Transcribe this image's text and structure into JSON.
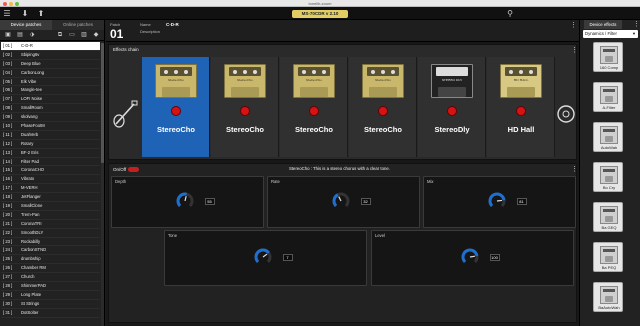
{
  "window": {
    "title": "tonelib-zoom"
  },
  "toolbar": {
    "device": "MS-70CDR v 2.10"
  },
  "left": {
    "tabs": [
      "Device patches",
      "Online patches"
    ],
    "patches": [
      {
        "num": "[ 01 ]",
        "name": "C-D-R"
      },
      {
        "num": "[ 02 ]",
        "name": "Sbiping6v"
      },
      {
        "num": "[ 03 ]",
        "name": "Deep Blue"
      },
      {
        "num": "[ 04 ]",
        "name": "CarbonLong"
      },
      {
        "num": "[ 05 ]",
        "name": "Elk Vibe"
      },
      {
        "num": "[ 06 ]",
        "name": "Mangle-tee"
      },
      {
        "num": "[ 07 ]",
        "name": "LOFI Noise"
      },
      {
        "num": "[ 08 ]",
        "name": "SmallRoom"
      },
      {
        "num": "[ 09 ]",
        "name": "skolvang"
      },
      {
        "num": "[ 10 ]",
        "name": "PhaseFootM"
      },
      {
        "num": "[ 11 ]",
        "name": "DualVerb"
      },
      {
        "num": "[ 12 ]",
        "name": "Rotary"
      },
      {
        "num": "[ 13 ]",
        "name": "BF-2 Eris"
      },
      {
        "num": "[ 14 ]",
        "name": "Filter Pad"
      },
      {
        "num": "[ 15 ]",
        "name": "CoronaCHO"
      },
      {
        "num": "[ 16 ]",
        "name": "Vibrato"
      },
      {
        "num": "[ 17 ]",
        "name": "M-VERH"
      },
      {
        "num": "[ 18 ]",
        "name": "JetFlanger"
      },
      {
        "num": "[ 19 ]",
        "name": "SmallClone"
      },
      {
        "num": "[ 20 ]",
        "name": "Trem-Pan"
      },
      {
        "num": "[ 21 ]",
        "name": "CoronaTRI"
      },
      {
        "num": "[ 22 ]",
        "name": "SmoothDLY"
      },
      {
        "num": "[ 23 ]",
        "name": "Rockabilly"
      },
      {
        "num": "[ 24 ]",
        "name": "CarbonSTND"
      },
      {
        "num": "[ 25 ]",
        "name": "drumbship"
      },
      {
        "num": "[ 26 ]",
        "name": "Chamber RM"
      },
      {
        "num": "[ 27 ]",
        "name": "Church"
      },
      {
        "num": "[ 28 ]",
        "name": "ShimmerPAD"
      },
      {
        "num": "[ 29 ]",
        "name": "Long Plate"
      },
      {
        "num": "[ 30 ]",
        "name": "St Strings"
      },
      {
        "num": "[ 31 ]",
        "name": "DotSolter"
      }
    ]
  },
  "patch": {
    "patch_label": "Patch",
    "number": "01",
    "name_label": "Name",
    "name": "C-D-R",
    "description_label": "Description"
  },
  "chain": {
    "title": "Effects chain",
    "slots": [
      {
        "name": "StereoCho",
        "pedal": "StereoCho",
        "style": "gold",
        "selected": true
      },
      {
        "name": "StereoCho",
        "pedal": "StereoCho",
        "style": "gold",
        "selected": false
      },
      {
        "name": "StereoCho",
        "pedal": "StereoCho",
        "style": "gold",
        "selected": false
      },
      {
        "name": "StereoCho",
        "pedal": "StereoCho",
        "style": "gold",
        "selected": false
      },
      {
        "name": "StereoDly",
        "pedal": "STEREO DLY",
        "style": "black",
        "selected": false
      },
      {
        "name": "HD Hall",
        "pedal": "HD HALL",
        "style": "cream",
        "selected": false
      }
    ]
  },
  "params": {
    "onoff_label": "On/Off",
    "description": "StereoCho : This is a stereo chorus with a clear tone.",
    "items": [
      {
        "label": "Depth",
        "value": "55",
        "level": 0.55
      },
      {
        "label": "Rate",
        "value": "32",
        "level": 0.4
      },
      {
        "label": "Mix",
        "value": "81",
        "level": 0.81
      },
      {
        "label": "Tone",
        "value": "7",
        "level": 0.7
      },
      {
        "label": "Level",
        "value": "100",
        "level": 0.8
      }
    ]
  },
  "right": {
    "tab": "Device effects",
    "category": "Dynamics / Filter",
    "effects": [
      "160 Comp",
      "A-Filter",
      "AutoWah",
      "Bo Cry",
      "Ba GEQ",
      "Ba PEQ",
      "BaAutoWah"
    ]
  },
  "colors": {
    "accent": "#1f63b6",
    "led": "#d41414",
    "knob": "#1f6fd0",
    "device_badge": "#e1cd63"
  }
}
